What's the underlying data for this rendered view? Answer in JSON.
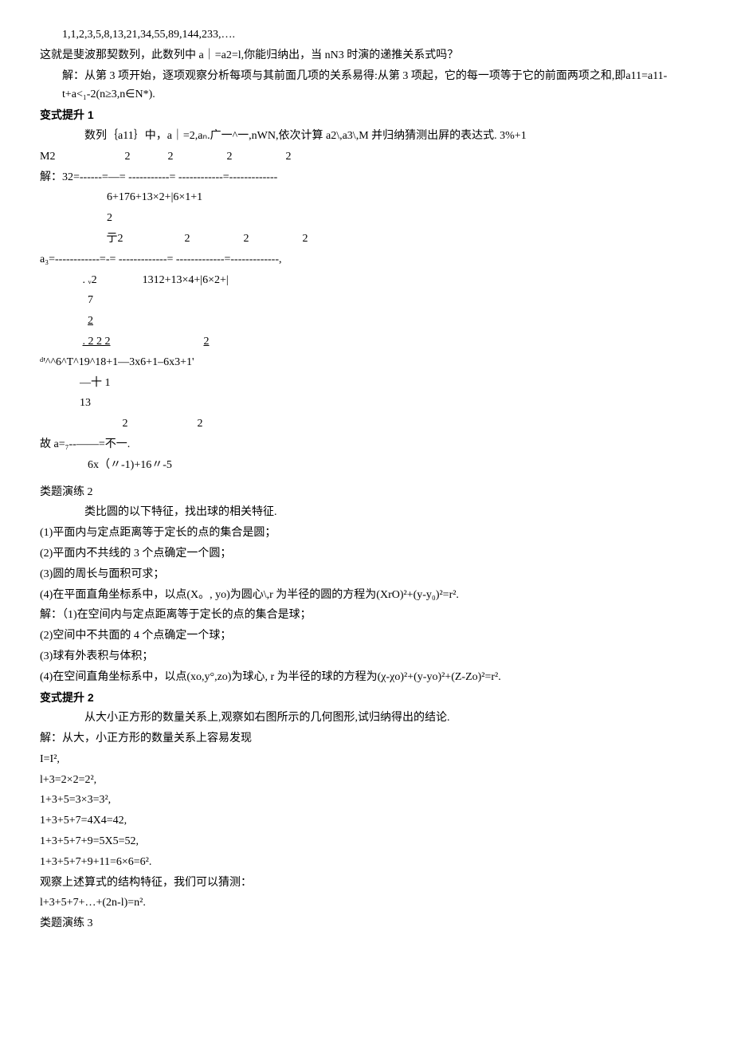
{
  "l1": "1,1,2,3,5,8,13,21,34,55,89,144,233,….",
  "l2": "这就是斐波那契数列，此数列中 a｜=a2=l,你能归纳出，当 nN3 时演的递推关系式吗？",
  "l3": "解：从第 3 项开始，逐项观察分析每项与其前面几项的关系易得:从第 3 项起，它的每一项等于它的前面两项之和,即a11=a11-t+a<₁-2(n≥3,n∈N*).",
  "h1": "变式提升 1",
  "l4": "数列｛a11｝中，a｜=2,aₙ.广一^一,nWN,依次计算 a2\\,a3\\,M 并归纳猜测出屛的表达式. 3%+1",
  "l5a": "M2",
  "l5b": "2",
  "l5c": "2",
  "l5d": "2",
  "l5e": "2",
  "l6": "解：32=------=—= -----------= ------------=-------------",
  "l7": "6+176+13×2+|6×1+1",
  "l8": "2",
  "l9a": "亍2",
  "l9b": "2",
  "l9c": "2",
  "l9d": "2",
  "l10": "a₃=------------=-= -------------= -------------=-------------,",
  "l11a": ". ᵥ2",
  "l11b": "1312+13×4+|6×2+|",
  "l12": "7",
  "l13": "2",
  "l14a": ".  2   2  2",
  "l14b": "2",
  "l15": "ᵈꞌ^^6^T^19^18+1—3x6+1–6x3+1'",
  "l16": "—十 1",
  "l17": "13",
  "l18a": "2",
  "l18b": "2",
  "l19": "故 a=₇--——=不一.",
  "l20": "6x（〃-1)+16〃-5",
  "l21": "类题演练 2",
  "l22": "类比圆的以下特征，找出球的相关特征.",
  "l23": "(1)平面内与定点距离等于定长的点的集合是圆；",
  "l24": "(2)平面内不共线的 3 个点确定一个圆；",
  "l25": "(3)圆的周长与面积可求；",
  "l26": "(4)在平面直角坐标系中，以点(X。, yo)为圆心\\,r 为半径的圆的方程为(XrO)²+(y-y₀)²=r².",
  "l27": "解：（1)在空间内与定点距离等于定长的点的集合是球；",
  "l28": "(2)空间中不共面的 4 个点确定一个球；",
  "l29": "(3)球有外表积与体积；",
  "l30": "(4)在空间直角坐标系中，以点(xo,y°,zo)为球心, r 为半径的球的方程为(χ-χo)²+(y-yo)²+(Z-Zo)²=r².",
  "h2": "变式提升 2",
  "l31": "从大小正方形的数量关系上,观察如右图所示的几何图形,试归纳得出的结论.",
  "l32": "解：从大，小正方形的数量关系上容易发现",
  "l33": "I=I²,",
  "l34": "l+3=2×2=2²,",
  "l35": "1+3+5=3×3=3²,",
  "l36": "1+3+5+7=4X4=42,",
  "l37": "1+3+5+7+9=5X5=52,",
  "l38": "1+3+5+7+9+11=6×6=6².",
  "l39": "观察上述算式的结构特征，我们可以猜测：",
  "l40": "l+3+5+7+…+(2n-l)=n².",
  "l41": "类题演练 3"
}
